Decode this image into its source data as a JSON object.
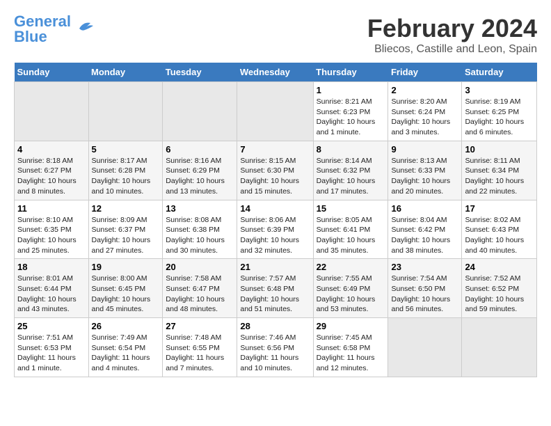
{
  "header": {
    "logo_line1": "General",
    "logo_line2": "Blue",
    "title": "February 2024",
    "subtitle": "Bliecos, Castille and Leon, Spain"
  },
  "columns": [
    "Sunday",
    "Monday",
    "Tuesday",
    "Wednesday",
    "Thursday",
    "Friday",
    "Saturday"
  ],
  "weeks": [
    [
      {
        "num": "",
        "info": "",
        "empty": true
      },
      {
        "num": "",
        "info": "",
        "empty": true
      },
      {
        "num": "",
        "info": "",
        "empty": true
      },
      {
        "num": "",
        "info": "",
        "empty": true
      },
      {
        "num": "1",
        "info": "Sunrise: 8:21 AM\nSunset: 6:23 PM\nDaylight: 10 hours\nand 1 minute."
      },
      {
        "num": "2",
        "info": "Sunrise: 8:20 AM\nSunset: 6:24 PM\nDaylight: 10 hours\nand 3 minutes."
      },
      {
        "num": "3",
        "info": "Sunrise: 8:19 AM\nSunset: 6:25 PM\nDaylight: 10 hours\nand 6 minutes."
      }
    ],
    [
      {
        "num": "4",
        "info": "Sunrise: 8:18 AM\nSunset: 6:27 PM\nDaylight: 10 hours\nand 8 minutes."
      },
      {
        "num": "5",
        "info": "Sunrise: 8:17 AM\nSunset: 6:28 PM\nDaylight: 10 hours\nand 10 minutes."
      },
      {
        "num": "6",
        "info": "Sunrise: 8:16 AM\nSunset: 6:29 PM\nDaylight: 10 hours\nand 13 minutes."
      },
      {
        "num": "7",
        "info": "Sunrise: 8:15 AM\nSunset: 6:30 PM\nDaylight: 10 hours\nand 15 minutes."
      },
      {
        "num": "8",
        "info": "Sunrise: 8:14 AM\nSunset: 6:32 PM\nDaylight: 10 hours\nand 17 minutes."
      },
      {
        "num": "9",
        "info": "Sunrise: 8:13 AM\nSunset: 6:33 PM\nDaylight: 10 hours\nand 20 minutes."
      },
      {
        "num": "10",
        "info": "Sunrise: 8:11 AM\nSunset: 6:34 PM\nDaylight: 10 hours\nand 22 minutes."
      }
    ],
    [
      {
        "num": "11",
        "info": "Sunrise: 8:10 AM\nSunset: 6:35 PM\nDaylight: 10 hours\nand 25 minutes."
      },
      {
        "num": "12",
        "info": "Sunrise: 8:09 AM\nSunset: 6:37 PM\nDaylight: 10 hours\nand 27 minutes."
      },
      {
        "num": "13",
        "info": "Sunrise: 8:08 AM\nSunset: 6:38 PM\nDaylight: 10 hours\nand 30 minutes."
      },
      {
        "num": "14",
        "info": "Sunrise: 8:06 AM\nSunset: 6:39 PM\nDaylight: 10 hours\nand 32 minutes."
      },
      {
        "num": "15",
        "info": "Sunrise: 8:05 AM\nSunset: 6:41 PM\nDaylight: 10 hours\nand 35 minutes."
      },
      {
        "num": "16",
        "info": "Sunrise: 8:04 AM\nSunset: 6:42 PM\nDaylight: 10 hours\nand 38 minutes."
      },
      {
        "num": "17",
        "info": "Sunrise: 8:02 AM\nSunset: 6:43 PM\nDaylight: 10 hours\nand 40 minutes."
      }
    ],
    [
      {
        "num": "18",
        "info": "Sunrise: 8:01 AM\nSunset: 6:44 PM\nDaylight: 10 hours\nand 43 minutes."
      },
      {
        "num": "19",
        "info": "Sunrise: 8:00 AM\nSunset: 6:45 PM\nDaylight: 10 hours\nand 45 minutes."
      },
      {
        "num": "20",
        "info": "Sunrise: 7:58 AM\nSunset: 6:47 PM\nDaylight: 10 hours\nand 48 minutes."
      },
      {
        "num": "21",
        "info": "Sunrise: 7:57 AM\nSunset: 6:48 PM\nDaylight: 10 hours\nand 51 minutes."
      },
      {
        "num": "22",
        "info": "Sunrise: 7:55 AM\nSunset: 6:49 PM\nDaylight: 10 hours\nand 53 minutes."
      },
      {
        "num": "23",
        "info": "Sunrise: 7:54 AM\nSunset: 6:50 PM\nDaylight: 10 hours\nand 56 minutes."
      },
      {
        "num": "24",
        "info": "Sunrise: 7:52 AM\nSunset: 6:52 PM\nDaylight: 10 hours\nand 59 minutes."
      }
    ],
    [
      {
        "num": "25",
        "info": "Sunrise: 7:51 AM\nSunset: 6:53 PM\nDaylight: 11 hours\nand 1 minute."
      },
      {
        "num": "26",
        "info": "Sunrise: 7:49 AM\nSunset: 6:54 PM\nDaylight: 11 hours\nand 4 minutes."
      },
      {
        "num": "27",
        "info": "Sunrise: 7:48 AM\nSunset: 6:55 PM\nDaylight: 11 hours\nand 7 minutes."
      },
      {
        "num": "28",
        "info": "Sunrise: 7:46 AM\nSunset: 6:56 PM\nDaylight: 11 hours\nand 10 minutes."
      },
      {
        "num": "29",
        "info": "Sunrise: 7:45 AM\nSunset: 6:58 PM\nDaylight: 11 hours\nand 12 minutes."
      },
      {
        "num": "",
        "info": "",
        "empty": true
      },
      {
        "num": "",
        "info": "",
        "empty": true
      }
    ]
  ]
}
